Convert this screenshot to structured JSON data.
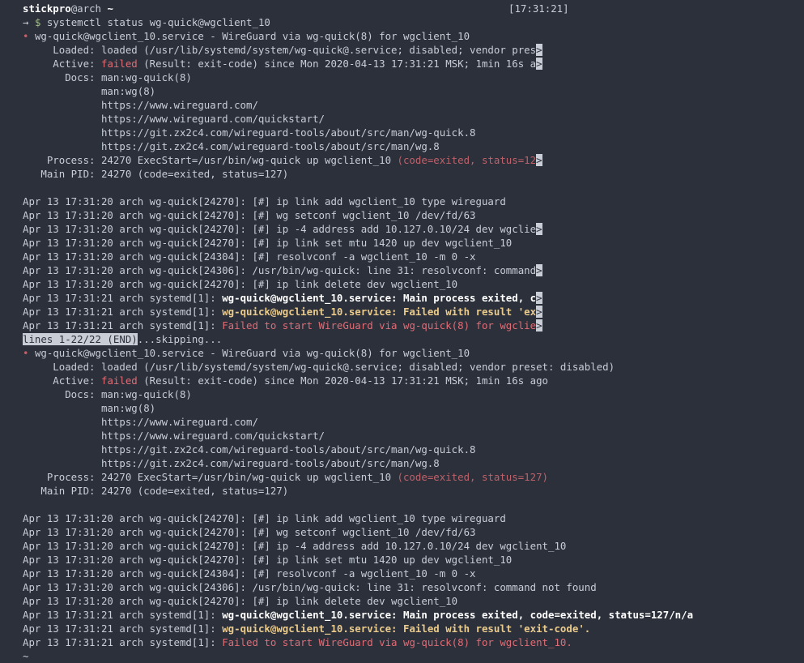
{
  "prompt": {
    "user": "stickpro",
    "host": "@arch",
    "dir": "~",
    "time": "[17:31:21]",
    "arrow": "→",
    "dollar": "$",
    "command": "systemctl status wg-quick@wgclient_10"
  },
  "status1": {
    "dot": "•",
    "header": "wg-quick@wgclient_10.service - WireGuard via wg-quick(8) for wgclient_10",
    "loaded": "     Loaded: loaded (/usr/lib/systemd/system/wg-quick@.service; disabled; vendor pres",
    "active_label": "     Active: ",
    "active_state": "failed",
    "active_rest": " (Result: exit-code) since Mon 2020-04-13 17:31:21 MSK; 1min 16s a",
    "docs": [
      "       Docs: man:wg-quick(8)",
      "             man:wg(8)",
      "             https://www.wireguard.com/",
      "             https://www.wireguard.com/quickstart/",
      "             https://git.zx2c4.com/wireguard-tools/about/src/man/wg-quick.8",
      "             https://git.zx2c4.com/wireguard-tools/about/src/man/wg.8"
    ],
    "process_plain": "    Process: 24270 ExecStart=/usr/bin/wg-quick up wgclient_10 ",
    "process_warn": "(code=exited, status=12",
    "mainpid": "   Main PID: 24270 (code=exited, status=127)",
    "logs_plain": [
      "Apr 13 17:31:20 arch wg-quick[24270]: [#] ip link add wgclient_10 type wireguard",
      "Apr 13 17:31:20 arch wg-quick[24270]: [#] wg setconf wgclient_10 /dev/fd/63",
      "Apr 13 17:31:20 arch wg-quick[24270]: [#] ip -4 address add 10.127.0.10/24 dev wgclie",
      "Apr 13 17:31:20 arch wg-quick[24270]: [#] ip link set mtu 1420 up dev wgclient_10",
      "Apr 13 17:31:20 arch wg-quick[24304]: [#] resolvconf -a wgclient_10 -m 0 -x",
      "Apr 13 17:31:20 arch wg-quick[24306]: /usr/bin/wg-quick: line 31: resolvconf: command",
      "Apr 13 17:31:20 arch wg-quick[24270]: [#] ip link delete dev wgclient_10"
    ],
    "log_prefix": "Apr 13 17:31:21 arch systemd[1]: ",
    "log_main": "wg-quick@wgclient_10.service: Main process exited, c",
    "log_failed_result": "wg-quick@wgclient_10.service: Failed with result 'ex",
    "log_failed_start": "Failed to start WireGuard via wg-quick(8) for wgclie",
    "trunc": ">"
  },
  "pager": {
    "status": "lines 1-22/22 (END)",
    "skipping": "...skipping..."
  },
  "status2": {
    "dot": "•",
    "header": "wg-quick@wgclient_10.service - WireGuard via wg-quick(8) for wgclient_10",
    "loaded": "     Loaded: loaded (/usr/lib/systemd/system/wg-quick@.service; disabled; vendor preset: disabled)",
    "active_label": "     Active: ",
    "active_state": "failed",
    "active_rest": " (Result: exit-code) since Mon 2020-04-13 17:31:21 MSK; 1min 16s ago",
    "docs": [
      "       Docs: man:wg-quick(8)",
      "             man:wg(8)",
      "             https://www.wireguard.com/",
      "             https://www.wireguard.com/quickstart/",
      "             https://git.zx2c4.com/wireguard-tools/about/src/man/wg-quick.8",
      "             https://git.zx2c4.com/wireguard-tools/about/src/man/wg.8"
    ],
    "process_plain": "    Process: 24270 ExecStart=/usr/bin/wg-quick up wgclient_10 ",
    "process_warn": "(code=exited, status=127)",
    "mainpid": "   Main PID: 24270 (code=exited, status=127)",
    "logs_plain": [
      "Apr 13 17:31:20 arch wg-quick[24270]: [#] ip link add wgclient_10 type wireguard",
      "Apr 13 17:31:20 arch wg-quick[24270]: [#] wg setconf wgclient_10 /dev/fd/63",
      "Apr 13 17:31:20 arch wg-quick[24270]: [#] ip -4 address add 10.127.0.10/24 dev wgclient_10",
      "Apr 13 17:31:20 arch wg-quick[24270]: [#] ip link set mtu 1420 up dev wgclient_10",
      "Apr 13 17:31:20 arch wg-quick[24304]: [#] resolvconf -a wgclient_10 -m 0 -x",
      "Apr 13 17:31:20 arch wg-quick[24306]: /usr/bin/wg-quick: line 31: resolvconf: command not found",
      "Apr 13 17:31:20 arch wg-quick[24270]: [#] ip link delete dev wgclient_10"
    ],
    "log_prefix": "Apr 13 17:31:21 arch systemd[1]: ",
    "log_main": "wg-quick@wgclient_10.service: Main process exited, code=exited, status=127/n/a",
    "log_failed_result": "wg-quick@wgclient_10.service: Failed with result 'exit-code'.",
    "log_failed_start": "Failed to start WireGuard via wg-quick(8) for wgclient_10."
  },
  "tilde": "~",
  "colors": {
    "background": "#2b303b",
    "foreground": "#c8cdd6",
    "failed": "#e06c75",
    "yellow": "#ebcb8b",
    "green": "#a3be8c"
  }
}
